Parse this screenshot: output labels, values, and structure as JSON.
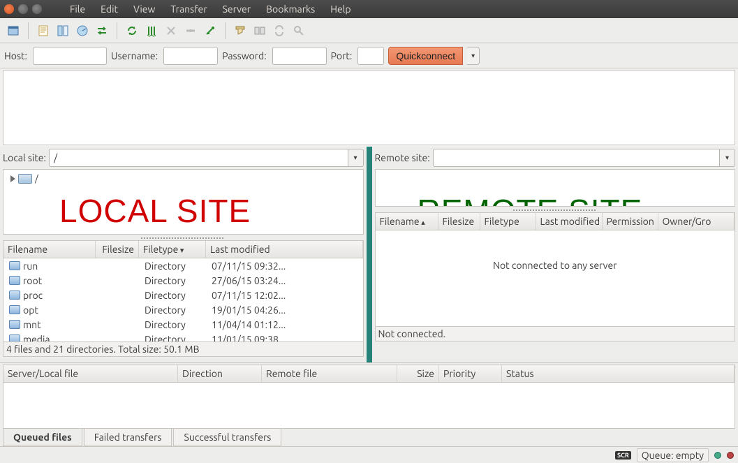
{
  "menubar": [
    "File",
    "Edit",
    "View",
    "Transfer",
    "Server",
    "Bookmarks",
    "Help"
  ],
  "quickbar": {
    "host_label": "Host:",
    "user_label": "Username:",
    "pass_label": "Password:",
    "port_label": "Port:",
    "button": "Quickconnect",
    "host": "",
    "username": "",
    "password": "",
    "port": ""
  },
  "local": {
    "label": "Local site:",
    "path": "/",
    "overlay": "LOCAL SITE",
    "columns": {
      "filename": "Filename",
      "filesize": "Filesize",
      "filetype": "Filetype",
      "modified": "Last modified"
    },
    "rows": [
      {
        "name": "run",
        "type": "Directory",
        "modified": "07/11/15 09:32..."
      },
      {
        "name": "root",
        "type": "Directory",
        "modified": "27/06/15 03:24..."
      },
      {
        "name": "proc",
        "type": "Directory",
        "modified": "07/11/15 12:02..."
      },
      {
        "name": "opt",
        "type": "Directory",
        "modified": "19/01/15 04:26..."
      },
      {
        "name": "mnt",
        "type": "Directory",
        "modified": "11/04/14 01:12..."
      },
      {
        "name": "media",
        "type": "Directory",
        "modified": "11/01/15 09:38"
      }
    ],
    "status": "4 files and 21 directories. Total size: 50.1 MB"
  },
  "remote": {
    "label": "Remote site:",
    "path": "",
    "overlay": "REMOTE SITE",
    "columns": {
      "filename": "Filename",
      "filesize": "Filesize",
      "filetype": "Filetype",
      "modified": "Last modified",
      "permission": "Permission",
      "owner": "Owner/Gro"
    },
    "empty_msg": "Not connected to any server",
    "status": "Not connected."
  },
  "queue": {
    "columns": {
      "server": "Server/Local file",
      "direction": "Direction",
      "remote": "Remote file",
      "size": "Size",
      "priority": "Priority",
      "status": "Status"
    }
  },
  "tabs": {
    "queued": "Queued files",
    "failed": "Failed transfers",
    "successful": "Successful transfers"
  },
  "statusbar": {
    "queue": "Queue: empty"
  },
  "toolbar_icons": [
    "site-manager-icon",
    "toggle-log-icon",
    "toggle-tree-icon",
    "toggle-queue-icon",
    "swap-icon",
    "refresh-icon",
    "process-queue-icon",
    "cancel-icon",
    "disconnect-icon",
    "reconnect-icon",
    "filter-icon",
    "compare-icon",
    "sync-icon",
    "find-icon"
  ]
}
